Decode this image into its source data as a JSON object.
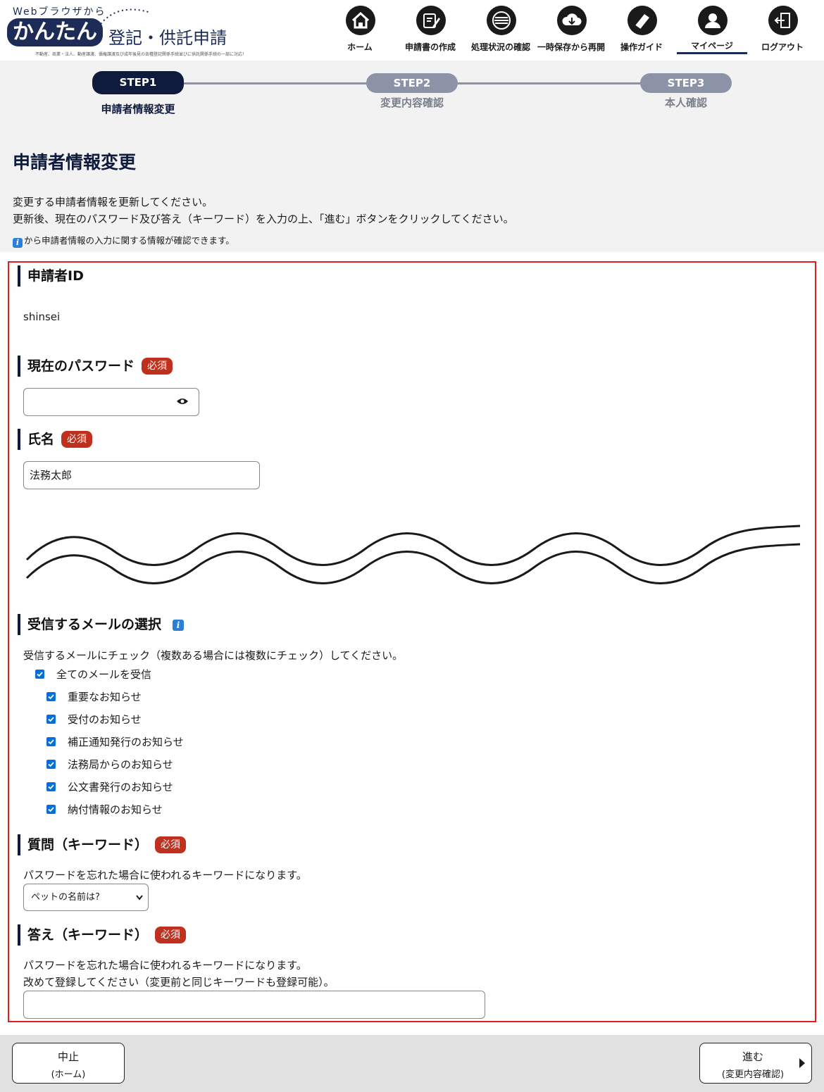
{
  "header": {
    "logo": {
      "top": "Webブラウザから",
      "kantan": "かんたん",
      "title": "登記・供託申請",
      "sub": "不動産、商業・法人、動産譲渡、債権譲渡及び成年後見の各種登記関係手続並びに供託関係手続の一部に対応！"
    },
    "nav": [
      {
        "label": "ホーム",
        "icon": "home-icon"
      },
      {
        "label": "申請書の作成",
        "icon": "pen-icon"
      },
      {
        "label": "処理状況の確認",
        "icon": "status-icon"
      },
      {
        "label": "一時保存から再開",
        "icon": "cloud-download-icon"
      },
      {
        "label": "操作ガイド",
        "icon": "guide-book-icon"
      },
      {
        "label": "マイページ",
        "icon": "user-icon",
        "active": true
      },
      {
        "label": "ログアウト",
        "icon": "logout-icon"
      }
    ]
  },
  "steps": [
    {
      "pill": "STEP1",
      "label": "申請者情報変更",
      "active": true
    },
    {
      "pill": "STEP2",
      "label": "変更内容確認",
      "active": false
    },
    {
      "pill": "STEP3",
      "label": "本人確認",
      "active": false
    }
  ],
  "page": {
    "title": "申請者情報変更",
    "desc1": "変更する申請者情報を更新してください。",
    "desc2": "更新後、現在のパスワード及び答え（キーワード）を入力の上、「進む」ボタンをクリックしてください。",
    "desc3": "から申請者情報の入力に関する情報が確認できます。",
    "info_glyph": "i"
  },
  "form": {
    "applicant_id": {
      "label": "申請者ID",
      "value": "shinsei"
    },
    "password": {
      "label": "現在のパスワード",
      "required": "必須",
      "value": ""
    },
    "name": {
      "label": "氏名",
      "required": "必須",
      "value": "法務太郎"
    },
    "mail": {
      "label": "受信するメールの選択",
      "note": "受信するメールにチェック（複数ある場合には複数にチェック）してください。",
      "all": "全てのメールを受信",
      "items": [
        "重要なお知らせ",
        "受付のお知らせ",
        "補正通知発行のお知らせ",
        "法務局からのお知らせ",
        "公文書発行のお知らせ",
        "納付情報のお知らせ"
      ],
      "checked": true
    },
    "question": {
      "label": "質問（キーワード）",
      "required": "必須",
      "note": "パスワードを忘れた場合に使われるキーワードになります。",
      "selected": "ペットの名前は?"
    },
    "answer": {
      "label": "答え（キーワード）",
      "required": "必須",
      "note1": "パスワードを忘れた場合に使われるキーワードになります。",
      "note2": "改めて登録してください（変更前と同じキーワードも登録可能）。",
      "value": ""
    }
  },
  "footer": {
    "cancel": {
      "line1": "中止",
      "line2": "(ホーム)"
    },
    "next": {
      "line1": "進む",
      "line2": "(変更内容確認)"
    }
  },
  "colors": {
    "navy": "#0f1b3d",
    "required": "#c0301e",
    "frame": "#e02020",
    "checkbox": "#0b6fd1",
    "step_inactive": "#8c93a6"
  }
}
